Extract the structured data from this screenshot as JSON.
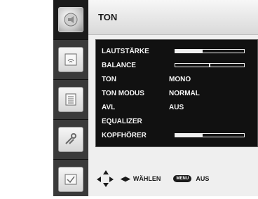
{
  "header": {
    "title": "TON"
  },
  "sidebar": {
    "items": [
      {
        "icon": "audio-sphere-icon"
      },
      {
        "icon": "screen-signal-icon"
      },
      {
        "icon": "list-document-icon"
      },
      {
        "icon": "wrench-tool-icon"
      },
      {
        "icon": "check-screen-icon"
      }
    ]
  },
  "menu": {
    "rows": [
      {
        "label": "LAUTSTÄRKE",
        "value": "",
        "level": 0.4
      },
      {
        "label": "BALANCE",
        "value": "",
        "marker": 0.5
      },
      {
        "label": "TON",
        "value": "MONO"
      },
      {
        "label": "TON MODUS",
        "value": "NORMAL"
      },
      {
        "label": "AVL",
        "value": "AUS"
      },
      {
        "label": "EQUALIZER",
        "value": ""
      },
      {
        "label": "KOPFHÖRER",
        "value": "",
        "level": 0.4
      }
    ]
  },
  "footer": {
    "nav_label": "WÄHLEN",
    "menu_key": "MENU",
    "exit_label": "AUS"
  },
  "colors": {
    "panel_bg": "#efefef",
    "list_bg": "#111111",
    "sidebar_bg": "#3a3a3a",
    "text_light": "#f5f5f5",
    "text_dark": "#1a1a1a"
  }
}
